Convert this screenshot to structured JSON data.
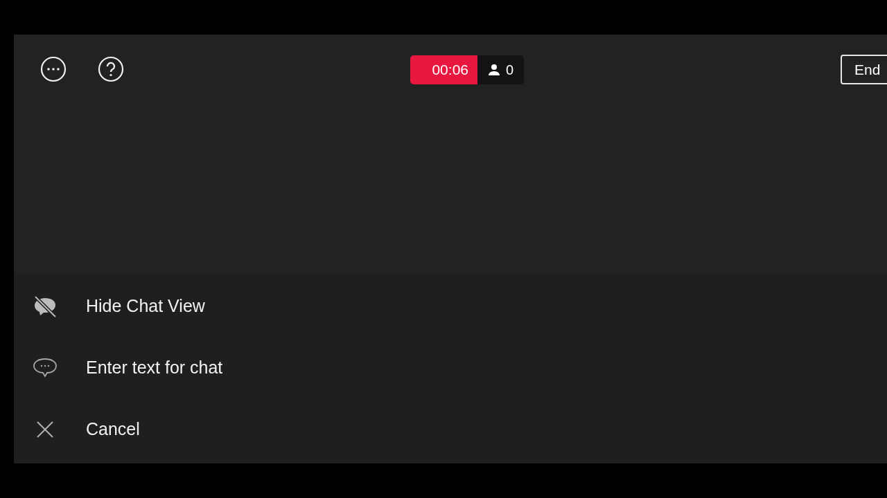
{
  "top_bar": {
    "timer": "00:06",
    "viewers": "0",
    "end_button": "End"
  },
  "menu": [
    {
      "kind": "hide",
      "label": "Hide Chat View"
    },
    {
      "kind": "chat",
      "label": "Enter text for chat"
    },
    {
      "kind": "cancel",
      "label": "Cancel"
    }
  ]
}
